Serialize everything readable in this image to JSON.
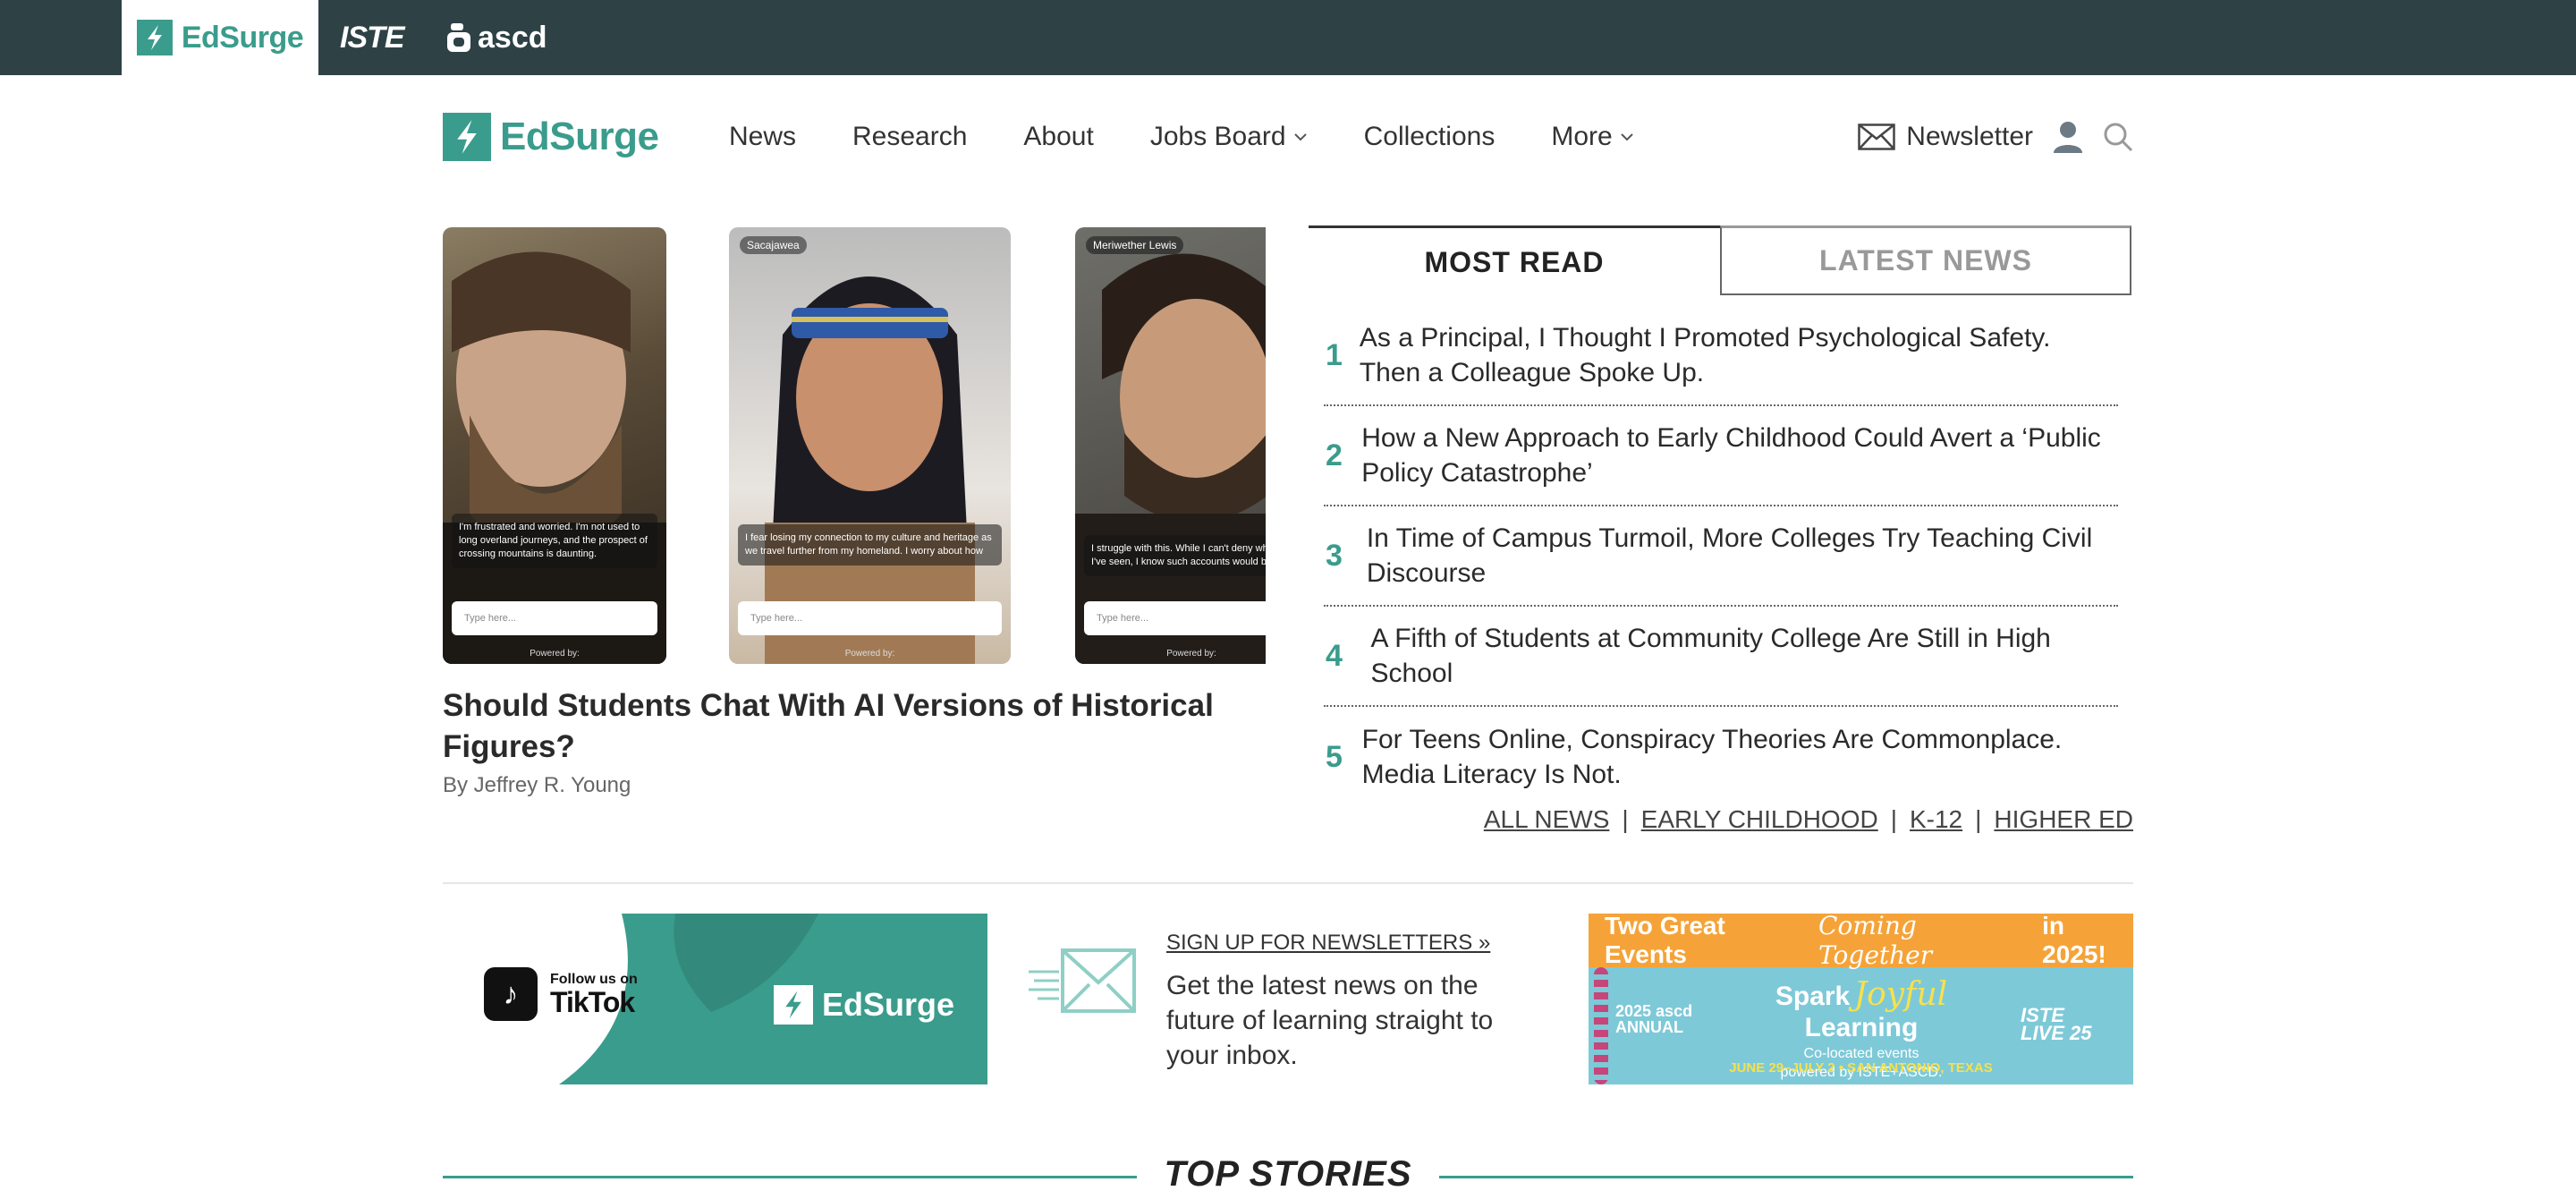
{
  "topbar": {
    "brands": [
      "EdSurge",
      "ISTE",
      "ascd"
    ]
  },
  "nav": {
    "logo": "EdSurge",
    "items": [
      "News",
      "Research",
      "About",
      "Jobs Board",
      "Collections",
      "More"
    ],
    "newsletter": "Newsletter"
  },
  "feature": {
    "cards": [
      "Sacajawea",
      "Meriwether Lewis"
    ],
    "card_msgs": [
      "I'm frustrated and worried. I'm not used to long overland journeys, and the prospect of crossing mountains is daunting.",
      "I fear losing my connection to my culture and heritage as we travel further from my homeland. I worry about how",
      "I struggle with this. While I can't deny what I've seen, I know such accounts would be met"
    ],
    "input_placeholder": "Type here...",
    "powered": "Powered by:",
    "headline": "Should Students Chat With AI Versions of Historical Figures?",
    "byline": "By Jeffrey R. Young"
  },
  "most_read": {
    "tab_active": "MOST READ",
    "tab_inactive": "LATEST NEWS",
    "items": [
      {
        "num": "1",
        "title": "As a Principal, I Thought I Promoted Psychological Safety. Then a Colleague Spoke Up."
      },
      {
        "num": "2",
        "title": "How a New Approach to Early Childhood Could Avert a ‘Public Policy Catastrophe’"
      },
      {
        "num": "3",
        "title": "In Time of Campus Turmoil, More Colleges Try Teaching Civil Discourse"
      },
      {
        "num": "4",
        "title": "A Fifth of Students at Community College Are Still in High School"
      },
      {
        "num": "5",
        "title": "For Teens Online, Conspiracy Theories Are Commonplace. Media Literacy Is Not."
      }
    ],
    "categories": [
      "ALL NEWS",
      "EARLY CHILDHOOD",
      "K-12",
      "HIGHER ED"
    ]
  },
  "promo": {
    "tiktok_small": "Follow us on",
    "tiktok_big": "TikTok",
    "tiktok_brand": "EdSurge",
    "newsletter_link": "SIGN UP FOR NEWSLETTERS »",
    "newsletter_desc": "Get the latest news on the future of learning straight to your inbox.",
    "ad": {
      "top_a": "Two Great Events",
      "top_b": "Coming Together",
      "top_c": "in 2025!",
      "left": "2025 ascd ANNUAL",
      "spark_a": "Spark",
      "spark_b": "Joyful",
      "spark_c": "Learning",
      "sub1": "Co-located events",
      "sub2": "powered by ISTE+ASCD.",
      "right": "ISTE LIVE 25",
      "date": "JUNE 29–JULY 2 • SAN ANTONIO, TEXAS"
    }
  },
  "top_stories": "TOP STORIES",
  "colors": {
    "teal": "#3a9c8c",
    "dark": "#2e4246"
  }
}
